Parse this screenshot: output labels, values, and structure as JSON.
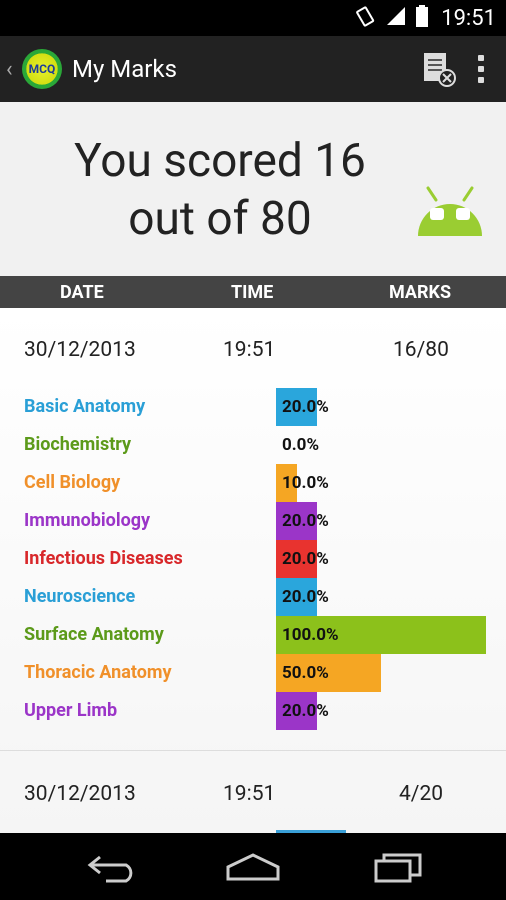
{
  "status": {
    "time": "19:51"
  },
  "app": {
    "title": "My Marks",
    "logo_text": "MCQ"
  },
  "score": {
    "line1": "You scored 16",
    "line2": "out of 80"
  },
  "table": {
    "col_date": "DATE",
    "col_time": "TIME",
    "col_marks": "MARKS"
  },
  "records": [
    {
      "date": "30/12/2013",
      "time": "19:51",
      "marks": "16/80",
      "subjects": [
        {
          "name": "Basic Anatomy",
          "pct_label": "20.0%",
          "value": 20,
          "color": "#2aa6dc"
        },
        {
          "name": "Biochemistry",
          "pct_label": "0.0%",
          "value": 0,
          "color": "#6a9e1f"
        },
        {
          "name": "Cell Biology",
          "pct_label": "10.0%",
          "value": 10,
          "color": "#f5a623"
        },
        {
          "name": "Immunobiology",
          "pct_label": "20.0%",
          "value": 20,
          "color": "#9b35c8"
        },
        {
          "name": "Infectious Diseases",
          "pct_label": "20.0%",
          "value": 20,
          "color": "#e8332f"
        },
        {
          "name": "Neuroscience",
          "pct_label": "20.0%",
          "value": 20,
          "color": "#2aa6dc"
        },
        {
          "name": "Surface Anatomy",
          "pct_label": "100.0%",
          "value": 100,
          "color": "#8cc11b"
        },
        {
          "name": "Thoracic Anatomy",
          "pct_label": "50.0%",
          "value": 50,
          "color": "#f5a623"
        },
        {
          "name": "Upper Limb",
          "pct_label": "20.0%",
          "value": 20,
          "color": "#9b35c8"
        }
      ]
    },
    {
      "date": "30/12/2013",
      "time": "19:51",
      "marks": "4/20"
    }
  ],
  "colors": {
    "subject_text": [
      "#2a9fd6",
      "#5c9a1a",
      "#f0902a",
      "#9b35c8",
      "#d8272a",
      "#2a9fd6",
      "#5c9a1a",
      "#f0902a",
      "#9b35c8"
    ]
  },
  "icons": [
    "signal-icon",
    "battery-icon",
    "clear-history-icon",
    "overflow-menu-icon",
    "android-icon",
    "back-nav-icon",
    "home-nav-icon",
    "recents-nav-icon"
  ]
}
